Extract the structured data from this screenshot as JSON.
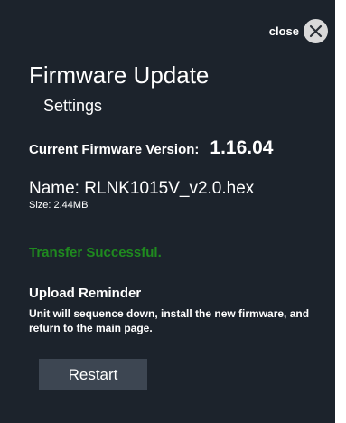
{
  "close": {
    "label": "close",
    "icon": "close-x-icon"
  },
  "header": {
    "title": "Firmware Update",
    "subtitle": "Settings"
  },
  "firmware": {
    "current_label": "Current Firmware Version:",
    "current_value": "1.16.04",
    "name_label": "Name:",
    "name_value": "RLNK1015V_v2.0.hex",
    "size_text": "Size: 2.44MB"
  },
  "status": {
    "text": "Transfer Successful.",
    "color": "#1f8a1f"
  },
  "reminder": {
    "title": "Upload Reminder",
    "text": "Unit will sequence down, install the new firmware, and return to the main page."
  },
  "actions": {
    "restart_label": "Restart"
  },
  "colors": {
    "panel_background": "#1c232c",
    "button_background": "#3d4652"
  }
}
